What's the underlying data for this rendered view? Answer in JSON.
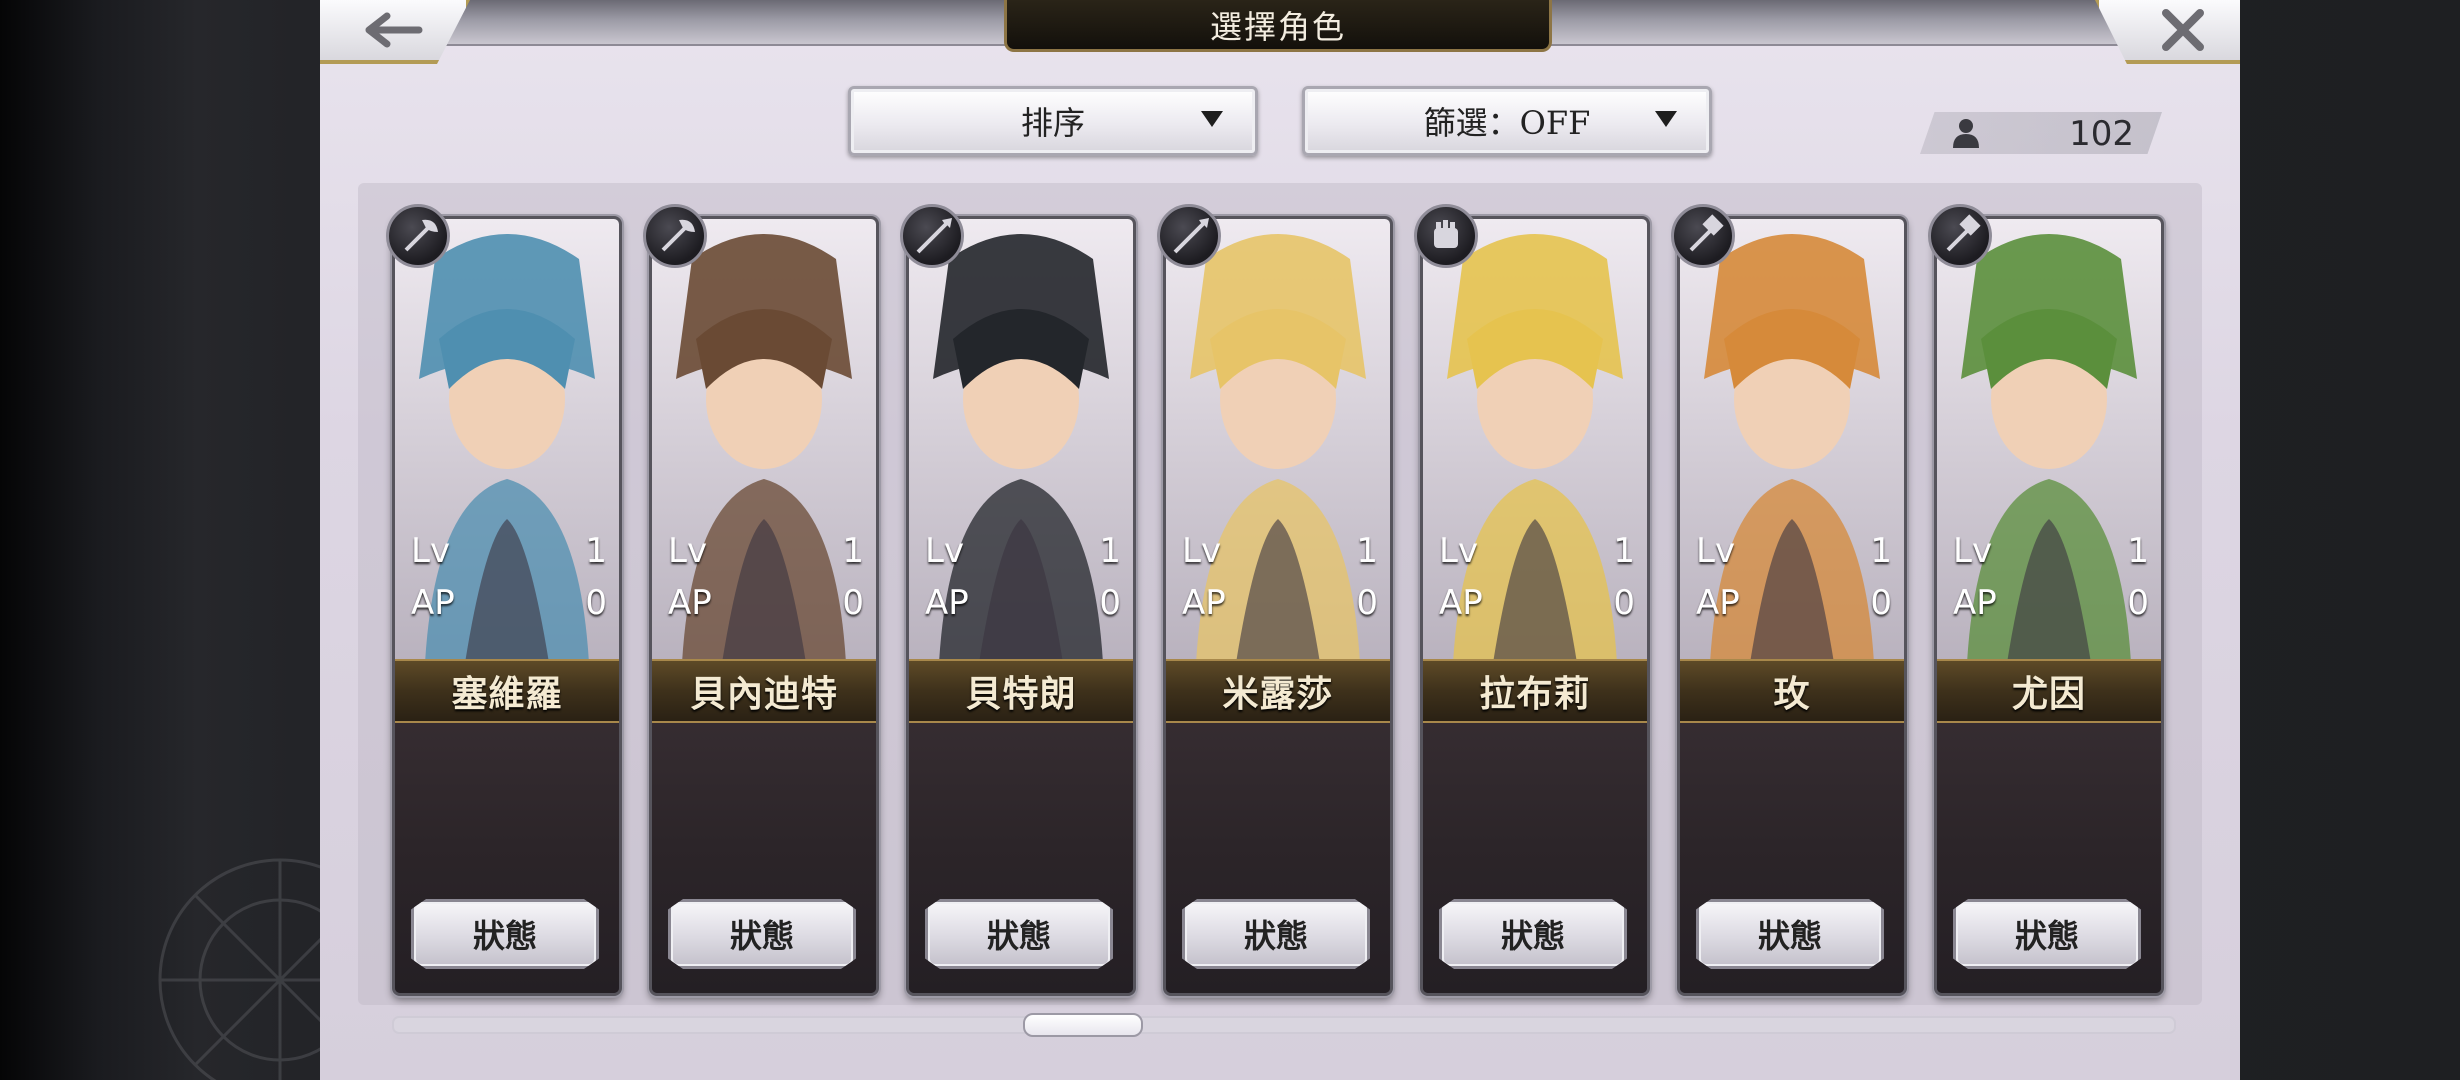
{
  "header": {
    "title": "選擇角色",
    "back_icon": "back-arrow-icon",
    "close_icon": "close-icon"
  },
  "controls": {
    "sort_label": "排序",
    "filter_label": "篩選：OFF",
    "character_count": "102"
  },
  "characters": [
    {
      "name": "塞維羅",
      "lv_label": "Lv",
      "lv": "1",
      "ap_label": "AP",
      "ap": "0",
      "status_label": "狀態",
      "weapon": "axe-icon",
      "accent": "#4f8fb0"
    },
    {
      "name": "貝內迪特",
      "lv_label": "Lv",
      "lv": "1",
      "ap_label": "AP",
      "ap": "0",
      "status_label": "狀態",
      "weapon": "axe-icon",
      "accent": "#6a4a34"
    },
    {
      "name": "貝特朗",
      "lv_label": "Lv",
      "lv": "1",
      "ap_label": "AP",
      "ap": "0",
      "status_label": "狀態",
      "weapon": "spear-icon",
      "accent": "#23262b"
    },
    {
      "name": "米露莎",
      "lv_label": "Lv",
      "lv": "1",
      "ap_label": "AP",
      "ap": "0",
      "status_label": "狀態",
      "weapon": "spear-icon",
      "accent": "#e7c468"
    },
    {
      "name": "拉布莉",
      "lv_label": "Lv",
      "lv": "1",
      "ap_label": "AP",
      "ap": "0",
      "status_label": "狀態",
      "weapon": "gauntlet-icon",
      "accent": "#e6c34f"
    },
    {
      "name": "玫",
      "lv_label": "Lv",
      "lv": "1",
      "ap_label": "AP",
      "ap": "0",
      "status_label": "狀態",
      "weapon": "hammer-icon",
      "accent": "#d68a3a"
    },
    {
      "name": "尤因",
      "lv_label": "Lv",
      "lv": "1",
      "ap_label": "AP",
      "ap": "0",
      "status_label": "狀態",
      "weapon": "hammer-icon",
      "accent": "#5b8f3c"
    }
  ],
  "colors": {
    "gold_trim": "#a8884b",
    "panel_bg": "#e9e4ee",
    "card_dark": "#2b2530"
  }
}
